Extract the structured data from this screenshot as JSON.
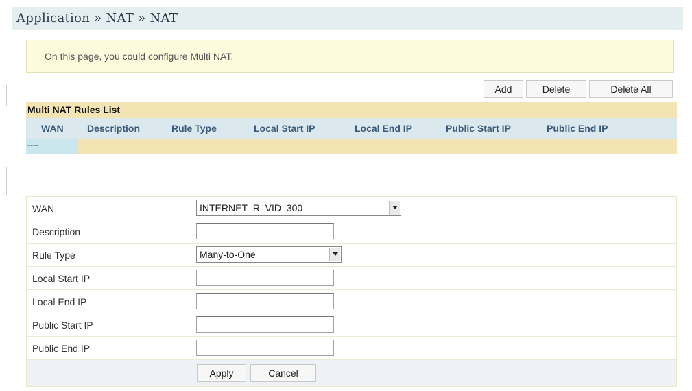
{
  "breadcrumb": {
    "parts": [
      "Application",
      "NAT",
      "NAT"
    ],
    "text": "Application » NAT » NAT"
  },
  "info": {
    "text": "On this page, you could configure Multi NAT."
  },
  "toolbar": {
    "add": "Add",
    "delete": "Delete",
    "delete_all": "Delete All"
  },
  "rules_list": {
    "title": "Multi NAT Rules List",
    "columns": [
      "WAN",
      "Description",
      "Rule Type",
      "Local Start IP",
      "Local End IP",
      "Public Start IP",
      "Public End IP"
    ],
    "empty_cell": "----"
  },
  "form": {
    "wan": {
      "label": "WAN",
      "value": "INTERNET_R_VID_300"
    },
    "description": {
      "label": "Description",
      "value": ""
    },
    "rule_type": {
      "label": "Rule Type",
      "value": "Many-to-One"
    },
    "local_start_ip": {
      "label": "Local Start IP",
      "value": ""
    },
    "local_end_ip": {
      "label": "Local End IP",
      "value": ""
    },
    "public_start_ip": {
      "label": "Public Start IP",
      "value": ""
    },
    "public_end_ip": {
      "label": "Public End IP",
      "value": ""
    },
    "apply": "Apply",
    "cancel": "Cancel"
  },
  "colors": {
    "breadcrumb_bg": "#e4eef0",
    "info_bg": "#fdfbdc",
    "list_title_bg": "#f3e5b3",
    "list_header_bg": "#dbe8ee",
    "list_header_text": "#3c5a78",
    "form_actions_bg": "#eef2f7"
  }
}
